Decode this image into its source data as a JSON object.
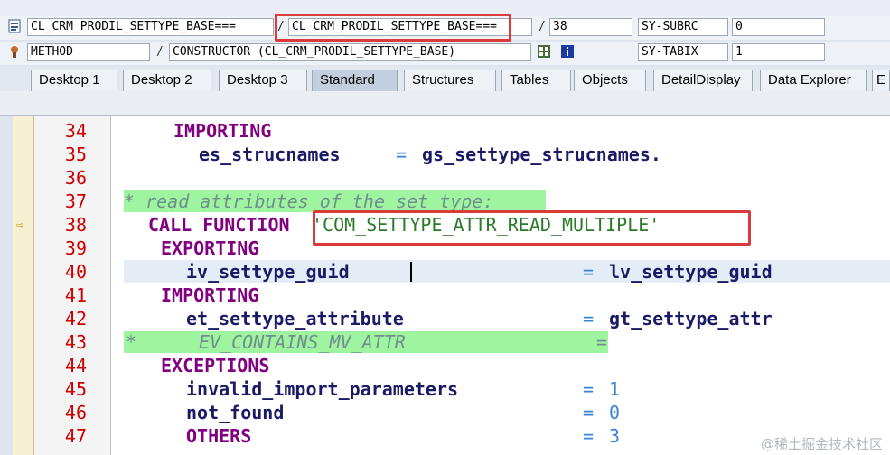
{
  "header": {
    "row1": {
      "field1": "CL_CRM_PRODIL_SETTYPE_BASE===",
      "field2": "CL_CRM_PRODIL_SETTYPE_BASE===",
      "line_no": "38",
      "var_name": "SY-SUBRC",
      "var_value": "0",
      "sep": "/"
    },
    "row2": {
      "kind": "METHOD",
      "method": "CONSTRUCTOR (CL_CRM_PRODIL_SETTYPE_BASE)",
      "var_name": "SY-TABIX",
      "var_value": "1",
      "sep": "/"
    }
  },
  "tabs": [
    "Desktop 1",
    "Desktop 2",
    "Desktop 3",
    "Standard",
    "Structures",
    "Tables",
    "Objects",
    "DetailDisplay",
    "Data Explorer",
    "E"
  ],
  "active_tab": "Standard",
  "code": {
    "line_numbers": [
      "34",
      "35",
      "36",
      "37",
      "38",
      "39",
      "40",
      "41",
      "42",
      "43",
      "44",
      "45",
      "46",
      "47"
    ],
    "l34": "IMPORTING",
    "l35_a": "es_strucnames",
    "l35_op": "=",
    "l35_b": "gs_settype_strucnames.",
    "l37": "* read attributes of the set type:",
    "l38_kw": "CALL FUNCTION",
    "l38_str": "'COM_SETTYPE_ATTR_READ_MULTIPLE'",
    "l39": "EXPORTING",
    "l40_a": "iv_settype_guid",
    "l40_op": "=",
    "l40_b": "lv_settype_guid",
    "l41": "IMPORTING",
    "l42_a": "et_settype_attribute",
    "l42_op": "=",
    "l42_b": "gt_settype_attr",
    "l43_star": "*",
    "l43_txt": "EV_CONTAINS_MV_ATTR",
    "l43_op": "=",
    "l44": "EXCEPTIONS",
    "l45_a": "invalid_import_parameters",
    "l45_op": "=",
    "l45_b": "1",
    "l46_a": "not_found",
    "l46_op": "=",
    "l46_b": "0",
    "l47_a": "OTHERS",
    "l47_op": "=",
    "l47_b": "3"
  },
  "icons": {
    "row1": "program-icon",
    "row2": "method-icon",
    "row2_extra": [
      "calculator-icon",
      "info-icon"
    ],
    "breakpoint": "current-line-arrow-icon"
  },
  "watermark": "@稀土掘金技术社区"
}
